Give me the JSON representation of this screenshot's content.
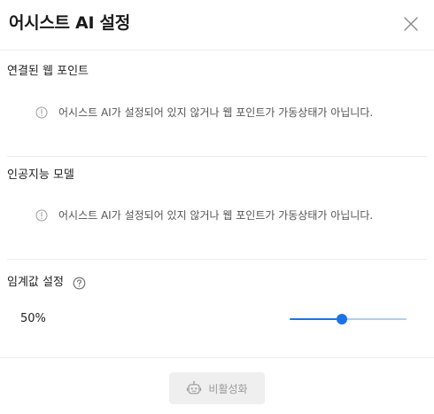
{
  "dialog": {
    "title": "어시스트 AI 설정",
    "close_icon": "close-icon"
  },
  "sections": {
    "web_point": {
      "title": "연결된 웹 포인트",
      "notice": "어시스트 AI가 설정되어 있지 않거나 웹 포인트가 가동상태가 아닙니다.",
      "icon": "info-circle-icon"
    },
    "ai_model": {
      "title": "인공지능 모델",
      "notice": "어시스트 AI가 설정되어 있지 않거나 웹 포인트가 가동상태가 아닙니다.",
      "icon": "info-circle-icon"
    },
    "threshold": {
      "title": "임계값 설정",
      "help_icon": "help-circle-icon",
      "value_text": "50%",
      "value_fraction": 0.45
    }
  },
  "footer": {
    "disable_label": "비활성화",
    "disable_icon": "robot-icon"
  },
  "colors": {
    "accent": "#1a73e8",
    "rail": "#a9d1f7",
    "disabled_bg": "#efefef",
    "disabled_text": "#9a9a9a"
  }
}
